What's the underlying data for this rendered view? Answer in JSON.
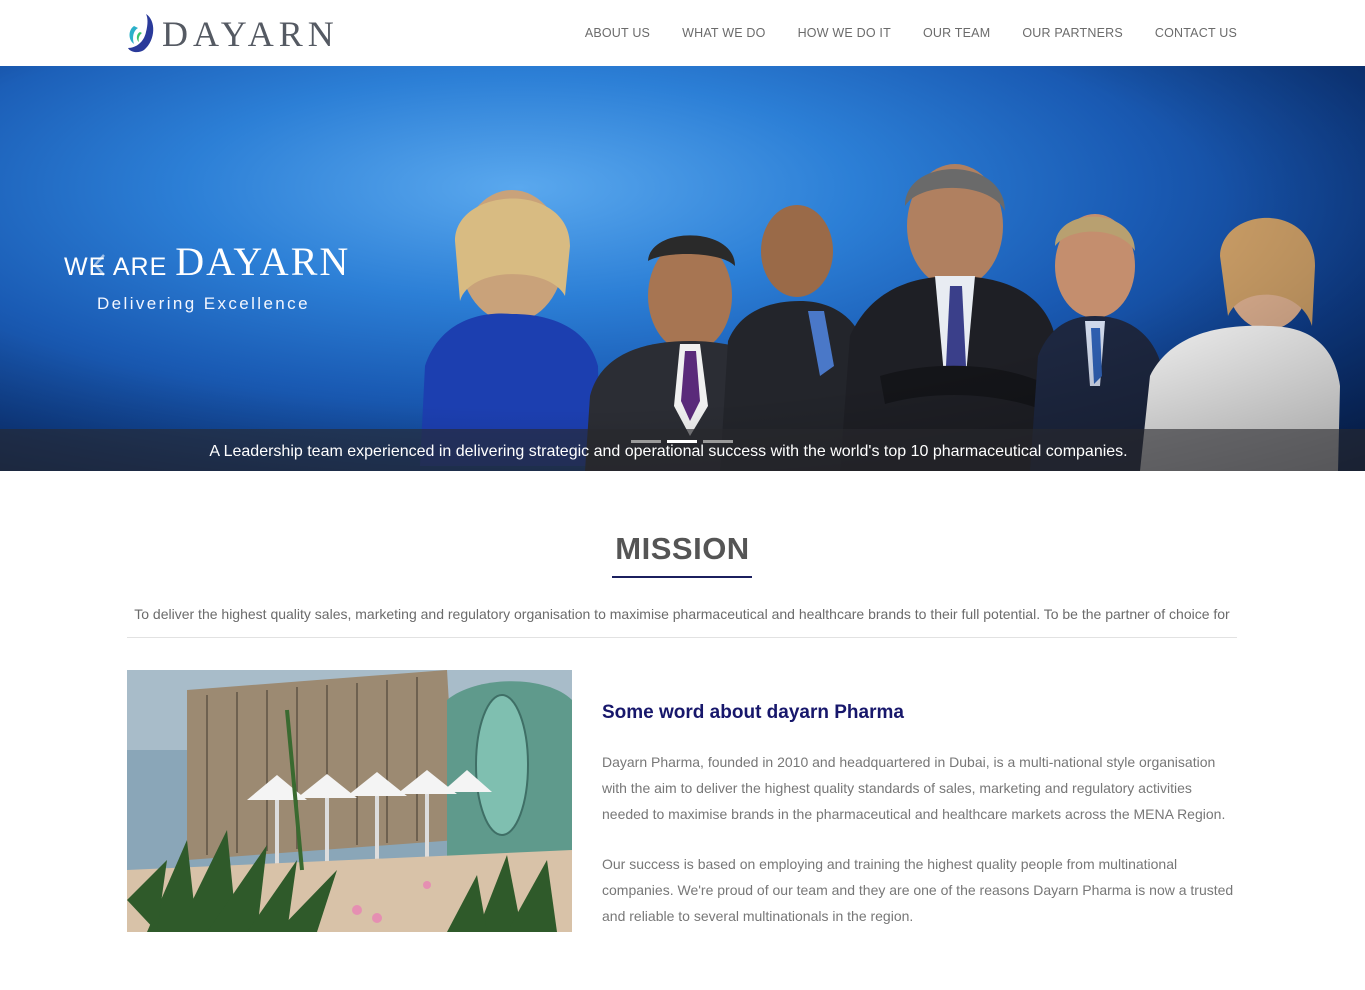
{
  "brand": {
    "name": "DAYARN"
  },
  "nav": {
    "items": [
      {
        "label": "ABOUT US"
      },
      {
        "label": "WHAT WE DO"
      },
      {
        "label": "HOW WE DO IT"
      },
      {
        "label": "OUR TEAM"
      },
      {
        "label": "OUR PARTNERS"
      },
      {
        "label": "CONTACT US"
      }
    ]
  },
  "hero": {
    "we_are": "WE ARE",
    "brand": "DAYARN",
    "tagline": "Delivering Excellence",
    "caption": "A Leadership team experienced in delivering strategic and operational success with the world's top 10 pharmaceutical companies.",
    "slide_count": 3,
    "active_slide": 2,
    "icons": {
      "prev": "chevron-left-icon"
    }
  },
  "mission": {
    "title": "MISSION",
    "text": "To deliver the highest quality sales, marketing and regulatory organisation to maximise pharmaceutical and healthcare brands to their full potential. To be the partner of choice for"
  },
  "about": {
    "heading": "Some word about dayarn Pharma",
    "paragraph1": "Dayarn Pharma, founded in 2010 and headquartered in Dubai, is a multi-national style organisation with the aim to deliver the highest quality standards of sales, marketing and regulatory activities needed to maximise brands in the pharmaceutical and healthcare markets across the MENA Region.",
    "paragraph2": "Our success is based on employing and training the highest quality people from multinational companies. We're proud of our team and they are one of the reasons Dayarn Pharma is now a trusted and reliable to several multinationals in the region."
  },
  "colors": {
    "accent_navy": "#17176b",
    "underline": "#1b1f5e",
    "hero_blue": "#1a5bb4"
  }
}
